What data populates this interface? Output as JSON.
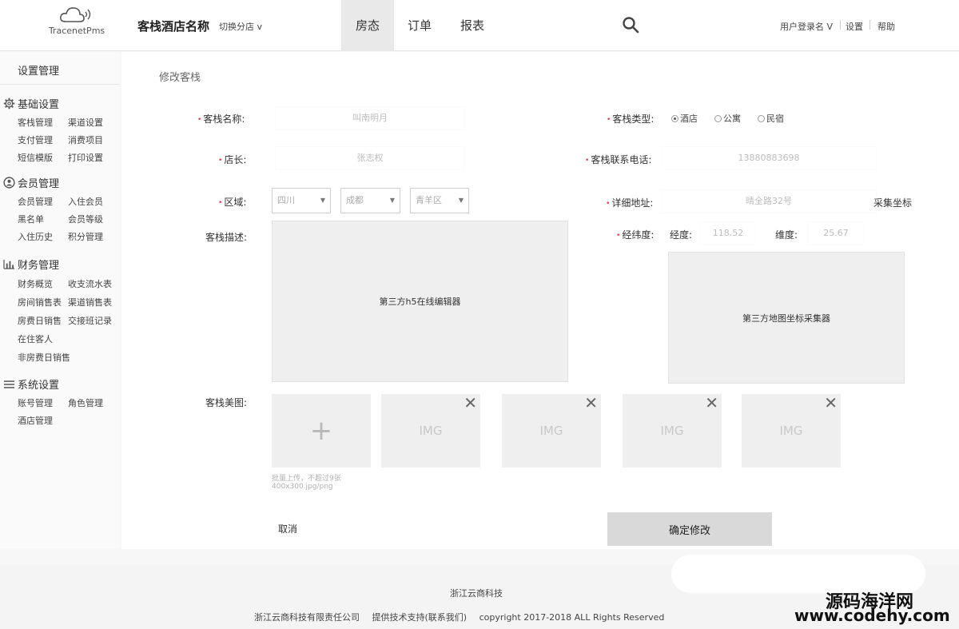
{
  "header": {
    "logo_text": "TracenetPms",
    "hotel_name": "客栈酒店名称",
    "switch_branch": "切换分店 v",
    "tabs": [
      {
        "label": "房态",
        "active": true
      },
      {
        "label": "订单",
        "active": false
      },
      {
        "label": "报表",
        "active": false
      }
    ],
    "user_menu": "用户登录名 V",
    "settings": "设置",
    "help": "帮助"
  },
  "sidebar": {
    "title": "设置管理",
    "groups": [
      {
        "title": "基础设置",
        "icon": "gear-icon",
        "items": [
          "客栈管理",
          "渠道设置",
          "支付管理",
          "消费项目",
          "短信模版",
          "打印设置"
        ]
      },
      {
        "title": "会员管理",
        "icon": "member-icon",
        "items": [
          "会员管理",
          "入住会员",
          "黑名单",
          "会员等级",
          "入住历史",
          "积分管理"
        ]
      },
      {
        "title": "财务管理",
        "icon": "bar-chart-icon",
        "items": [
          "财务概览",
          "收支流水表",
          "房间销售表",
          "渠道销售表",
          "房费日销售",
          "交接班记录",
          "在住客人",
          "非房费日销售"
        ]
      },
      {
        "title": "系统设置",
        "icon": "menu-lines-icon",
        "items": [
          "账号管理",
          "角色管理",
          "酒店管理"
        ]
      }
    ]
  },
  "form": {
    "page_title": "修改客栈",
    "required_mark": "•",
    "name_label": "客栈名称:",
    "name_value": "叫南明月",
    "type_label": "客栈类型:",
    "type_options": [
      {
        "label": "酒店",
        "checked": true
      },
      {
        "label": "公寓",
        "checked": false
      },
      {
        "label": "民宿",
        "checked": false
      }
    ],
    "manager_label": "店长:",
    "manager_value": "张志权",
    "phone_label": "客栈联系电话:",
    "phone_value": "13880883698",
    "region_label": "区域:",
    "region_province": "四川",
    "region_city": "成都",
    "region_district": "青羊区",
    "address_label": "详细地址:",
    "address_value": "晴全路32号",
    "collect_coords": "采集坐标",
    "coords_label": "经纬度:",
    "lng_label": "经度:",
    "lng_value": "118.52",
    "lat_label": "维度:",
    "lat_value": "25.67",
    "desc_label": "客栈描述:",
    "editor_text": "第三方h5在线编辑器",
    "map_text": "第三方地图坐标采集器",
    "images_label": "客栈美图:",
    "upload_symbol": "+",
    "images": [
      "IMG",
      "IMG",
      "IMG",
      "IMG"
    ],
    "close_symbol": "✕",
    "upload_hint_1": "批量上传，不超过9张",
    "upload_hint_2": "400x300.jpg/png",
    "cancel": "取消",
    "submit": "确定修改"
  },
  "footer": {
    "company_short": "浙江云商科技",
    "company_full": "浙江云商科技有限责任公司",
    "support": "提供技术支持(联系我们)",
    "copyright": "copyright 2017-2018 ALL Rights Reserved"
  },
  "watermark": {
    "title": "源码海洋网",
    "url": "www.codehy.com"
  }
}
